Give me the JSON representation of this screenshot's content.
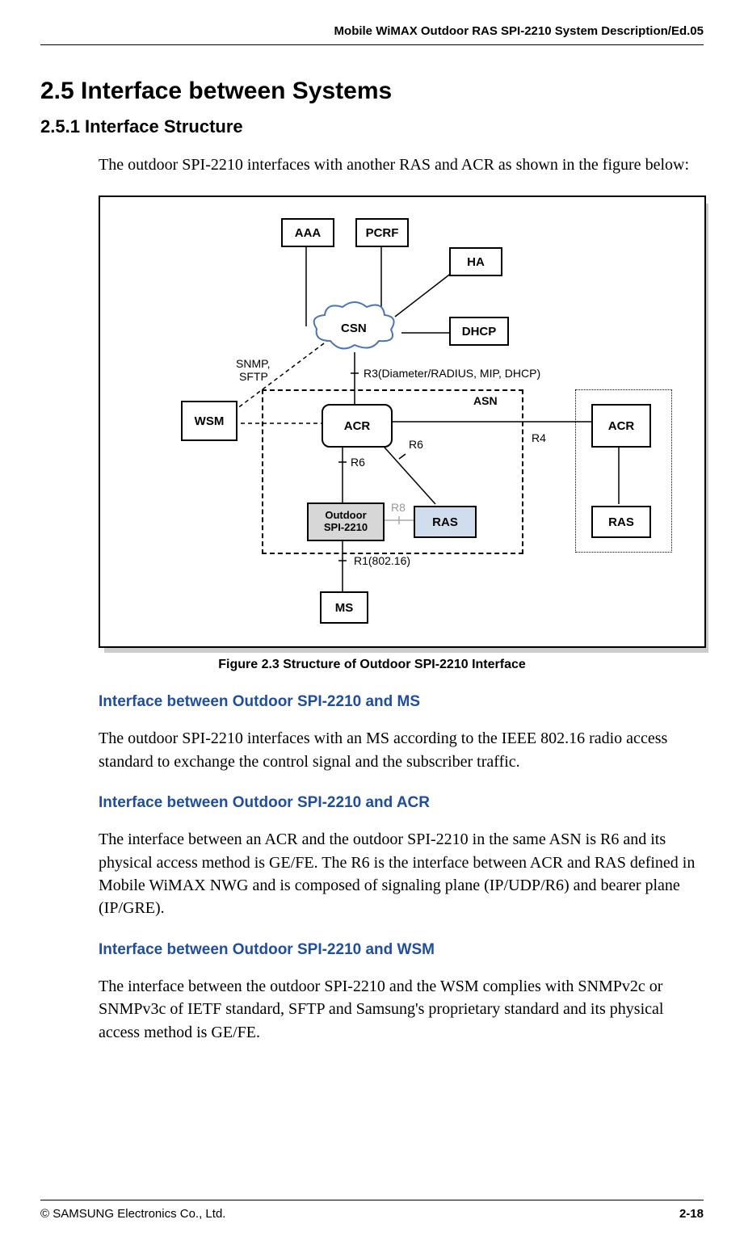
{
  "header": {
    "title": "Mobile WiMAX Outdoor RAS SPI-2210 System Description/Ed.05"
  },
  "footer": {
    "copyright": "© SAMSUNG Electronics Co., Ltd.",
    "page": "2-18"
  },
  "section": {
    "num_title": "2.5  Interface between Systems"
  },
  "subsection": {
    "num_title": "2.5.1  Interface Structure"
  },
  "intro": "The outdoor SPI-2210 interfaces with another RAS and ACR as shown in the figure below:",
  "figure": {
    "caption": "Figure 2.3    Structure of Outdoor SPI-2210 Interface",
    "nodes": {
      "aaa": "AAA",
      "pcrf": "PCRF",
      "ha": "HA",
      "dhcp": "DHCP",
      "csn": "CSN",
      "wsm": "WSM",
      "acr": "ACR",
      "acr2": "ACR",
      "outdoor_line1": "Outdoor",
      "outdoor_line2": "SPI-2210",
      "ras": "RAS",
      "ras2": "RAS",
      "ms": "MS",
      "asn": "ASN"
    },
    "labels": {
      "snmp": "SNMP,",
      "sftp": "SFTP",
      "r3": "R3(Diameter/RADIUS, MIP, DHCP)",
      "r6a": "R6",
      "r6b": "R6",
      "r4": "R4",
      "r8": "R8",
      "r1": "R1(802.16)"
    }
  },
  "sections": {
    "s1": {
      "title": "Interface between Outdoor SPI-2210 and MS",
      "body": "The outdoor SPI-2210 interfaces with an MS according to the IEEE 802.16 radio access standard to exchange the control signal and the subscriber traffic."
    },
    "s2": {
      "title": "Interface between Outdoor SPI-2210 and ACR",
      "body": "The interface between an ACR and the outdoor SPI-2210 in the same ASN is R6 and its physical access method is GE/FE. The R6 is the interface between ACR and RAS defined in Mobile WiMAX NWG and is composed of signaling plane (IP/UDP/R6) and bearer plane (IP/GRE)."
    },
    "s3": {
      "title": "Interface between Outdoor SPI-2210 and WSM",
      "body": "The interface between the outdoor SPI-2210 and the WSM complies with SNMPv2c or SNMPv3c of IETF standard, SFTP and Samsung's proprietary standard and its physical access method is GE/FE."
    }
  }
}
